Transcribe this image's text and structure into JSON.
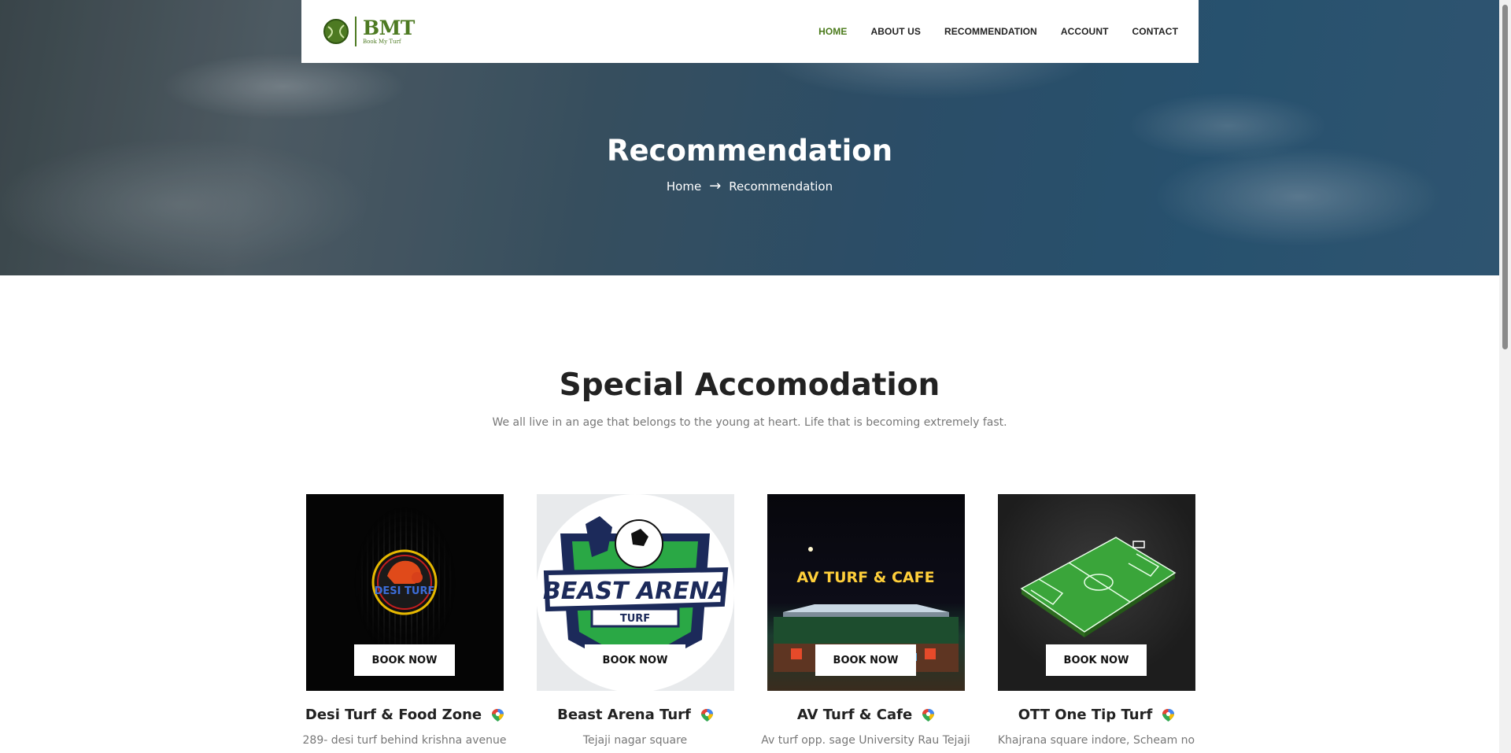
{
  "header": {
    "logo_main": "BMT",
    "logo_sub": "Book My Turf",
    "nav": [
      {
        "label": "HOME",
        "active": true
      },
      {
        "label": "ABOUT US"
      },
      {
        "label": "RECOMMENDATION"
      },
      {
        "label": "ACCOUNT"
      },
      {
        "label": "CONTACT"
      }
    ]
  },
  "hero": {
    "title": "Recommendation",
    "breadcrumb_home": "Home",
    "breadcrumb_arrow": "→",
    "breadcrumb_current": "Recommendation"
  },
  "section": {
    "title": "Special Accomodation",
    "subtitle": "We all live in an age that belongs to the young at heart. Life that is becoming extremely fast."
  },
  "cards": [
    {
      "name": "Desi Turf & Food Zone",
      "address": "289- desi turf behind krishna avenue",
      "button": "BOOK NOW",
      "logo_text": "DESI TURF"
    },
    {
      "name": "Beast Arena Turf",
      "address": "Tejaji nagar square",
      "button": "BOOK NOW",
      "logo_text": "BEAST ARENA",
      "logo_sub": "TURF"
    },
    {
      "name": "AV Turf & Cafe",
      "address": "Av turf opp. sage University Rau Tejaji",
      "button": "BOOK NOW",
      "sign_text": "AV TURF & CAFE"
    },
    {
      "name": "OTT One Tip Turf",
      "address": "Khajrana square indore, Scheam no",
      "button": "BOOK NOW"
    }
  ],
  "colors": {
    "brand_green": "#4d7a22",
    "nav_active": "#4a7a1a"
  },
  "icons": {
    "map": "google-maps-pin-icon",
    "arrow": "arrow-right-icon"
  }
}
